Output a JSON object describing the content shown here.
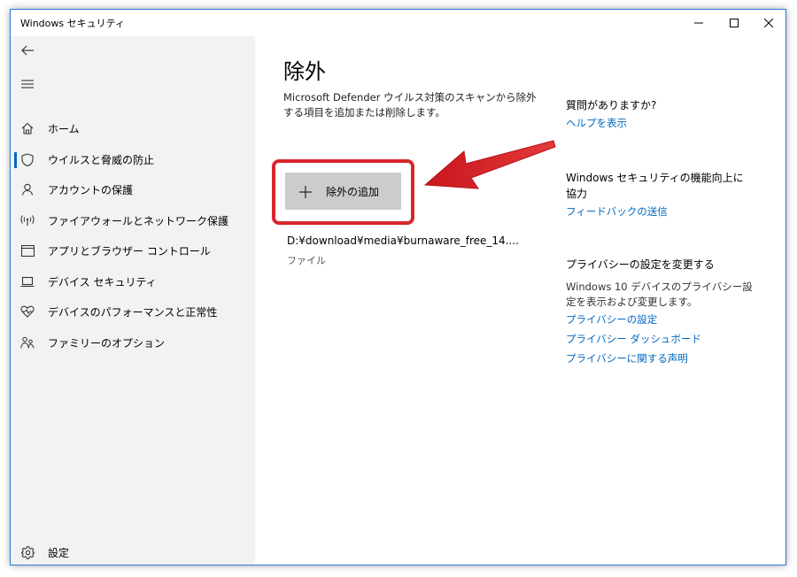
{
  "window": {
    "title": "Windows セキュリティ"
  },
  "sidebar": {
    "items": [
      {
        "label": "ホーム",
        "icon": "home-icon"
      },
      {
        "label": "ウイルスと脅威の防止",
        "icon": "shield-icon",
        "active": true
      },
      {
        "label": "アカウントの保護",
        "icon": "person-icon"
      },
      {
        "label": "ファイアウォールとネットワーク保護",
        "icon": "wifi-antenna-icon"
      },
      {
        "label": "アプリとブラウザー コントロール",
        "icon": "browser-window-icon"
      },
      {
        "label": "デバイス セキュリティ",
        "icon": "laptop-icon"
      },
      {
        "label": "デバイスのパフォーマンスと正常性",
        "icon": "heart-pulse-icon"
      },
      {
        "label": "ファミリーのオプション",
        "icon": "family-icon"
      }
    ],
    "settings_label": "設定"
  },
  "main": {
    "title": "除外",
    "description": "Microsoft Defender ウイルス対策のスキャンから除外する項目を追加または削除します。",
    "add_button_label": "除外の追加",
    "exclusion": {
      "path": "D:¥download¥media¥burnaware_free_14....",
      "type": "ファイル"
    }
  },
  "side": {
    "help": {
      "heading": "質問がありますか?",
      "link": "ヘルプを表示"
    },
    "feedback": {
      "heading": "Windows セキュリティの機能向上に協力",
      "link": "フィードバックの送信"
    },
    "privacy": {
      "heading": "プライバシーの設定を変更する",
      "text": "Windows 10 デバイスのプライバシー設定を表示および変更します。",
      "links": [
        "プライバシーの設定",
        "プライバシー ダッシュボード",
        "プライバシーに関する声明"
      ]
    }
  },
  "colors": {
    "accent": "#0067c0",
    "highlight": "#d9262c",
    "sidebar_bg": "#f2f2f2",
    "button_bg": "#cccccc"
  }
}
